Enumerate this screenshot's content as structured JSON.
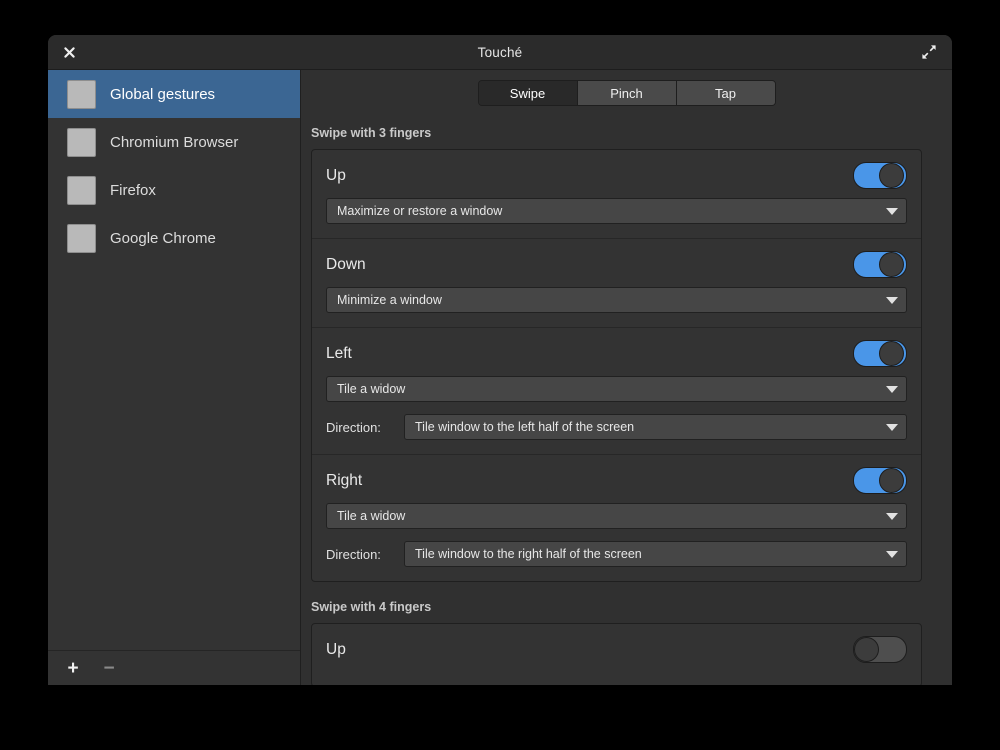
{
  "window": {
    "title": "Touché",
    "close_icon": "close-icon",
    "maximize_icon": "maximize-icon"
  },
  "sidebar": {
    "items": [
      {
        "label": "Global gestures",
        "icon": "app-placeholder-icon",
        "selected": true
      },
      {
        "label": "Chromium Browser",
        "icon": "app-placeholder-icon",
        "selected": false
      },
      {
        "label": "Firefox",
        "icon": "app-placeholder-icon",
        "selected": false
      },
      {
        "label": "Google Chrome",
        "icon": "app-placeholder-icon",
        "selected": false
      }
    ],
    "toolbar": {
      "add_label": "+",
      "remove_label": "−"
    }
  },
  "tabs": [
    {
      "label": "Swipe",
      "active": true
    },
    {
      "label": "Pinch",
      "active": false
    },
    {
      "label": "Tap",
      "active": false
    }
  ],
  "sections": [
    {
      "title": "Swipe with 3 fingers",
      "gestures": [
        {
          "name": "Up",
          "enabled": true,
          "action": "Maximize or restore a window",
          "direction_label": null,
          "direction_value": null
        },
        {
          "name": "Down",
          "enabled": true,
          "action": "Minimize a window",
          "direction_label": null,
          "direction_value": null
        },
        {
          "name": "Left",
          "enabled": true,
          "action": "Tile a widow",
          "direction_label": "Direction:",
          "direction_value": "Tile window to the left half of the screen"
        },
        {
          "name": "Right",
          "enabled": true,
          "action": "Tile a widow",
          "direction_label": "Direction:",
          "direction_value": "Tile window to the right half of the screen"
        }
      ]
    },
    {
      "title": "Swipe with 4 fingers",
      "gestures": [
        {
          "name": "Up",
          "enabled": false,
          "action": null,
          "direction_label": null,
          "direction_value": null
        }
      ]
    }
  ],
  "colors": {
    "accent_selection": "#3b6693",
    "toggle_on": "#4a96e8",
    "window_bg": "#303030",
    "sidebar_bg": "#333333",
    "titlebar_bg": "#2b2b2b",
    "desktop_bg": "#000000"
  }
}
